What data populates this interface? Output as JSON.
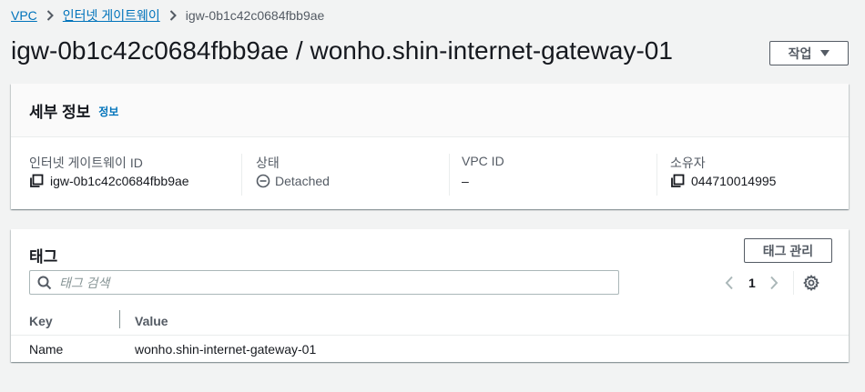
{
  "breadcrumb": {
    "items": [
      "VPC",
      "인터넷 게이트웨이"
    ],
    "current": "igw-0b1c42c0684fbb9ae"
  },
  "page": {
    "title": "igw-0b1c42c0684fbb9ae / wonho.shin-internet-gateway-01",
    "actions_label": "작업"
  },
  "details": {
    "heading": "세부 정보",
    "info_link": "정보",
    "fields": [
      {
        "key": "인터넷 게이트웨이 ID",
        "value": "igw-0b1c42c0684fbb9ae",
        "icon": "copy-icon"
      },
      {
        "key": "상태",
        "value": "Detached",
        "icon": "status-stopped-icon"
      },
      {
        "key": "VPC ID",
        "value": "–"
      },
      {
        "key": "소유자",
        "value": "044710014995",
        "icon": "copy-icon"
      }
    ]
  },
  "tags": {
    "heading": "태그",
    "manage_label": "태그 관리",
    "search_placeholder": "태그 검색",
    "page_number": "1",
    "columns": [
      "Key",
      "Value"
    ],
    "rows": [
      {
        "key": "Name",
        "value": "wonho.shin-internet-gateway-01"
      }
    ]
  },
  "colors": {
    "link": "#0073bb",
    "background": "#f2f3f3",
    "text": "#16191f",
    "muted": "#545b64"
  }
}
